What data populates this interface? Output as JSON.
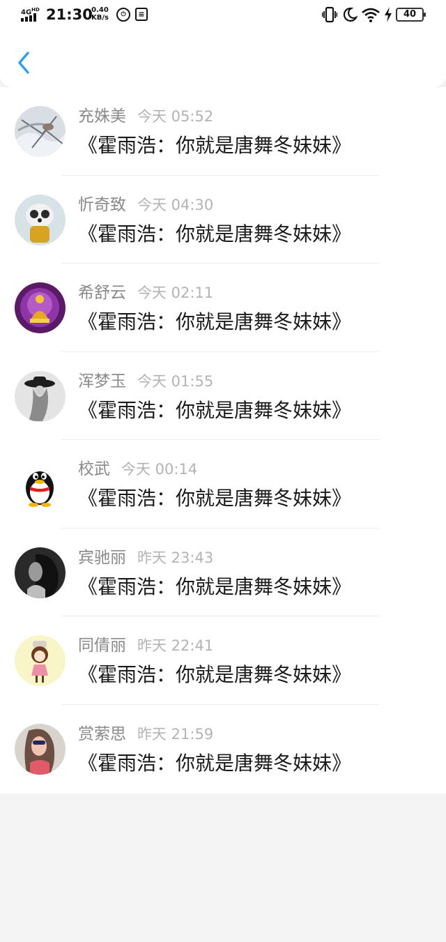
{
  "status_bar": {
    "network": "4G",
    "network_sup": "HD",
    "time": "21:30",
    "speed_value": "0.40",
    "speed_unit": "KB/s",
    "battery": "40"
  },
  "header": {
    "back_icon": "chevron-left-icon",
    "accent": "#2b9ef0"
  },
  "messages": [
    {
      "name": "充姝美",
      "time": "今天 05:52",
      "text": "《霍雨浩：你就是唐舞冬妹妹》"
    },
    {
      "name": "忻奇致",
      "time": "今天 04:30",
      "text": "《霍雨浩：你就是唐舞冬妹妹》"
    },
    {
      "name": "希舒云",
      "time": "今天 02:11",
      "text": "《霍雨浩：你就是唐舞冬妹妹》"
    },
    {
      "name": "浑梦玉",
      "time": "今天 01:55",
      "text": "《霍雨浩：你就是唐舞冬妹妹》"
    },
    {
      "name": "校武",
      "time": "今天 00:14",
      "text": "《霍雨浩：你就是唐舞冬妹妹》"
    },
    {
      "name": "宾驰丽",
      "time": "昨天 23:43",
      "text": "《霍雨浩：你就是唐舞冬妹妹》"
    },
    {
      "name": "同倩丽",
      "time": "昨天 22:41",
      "text": "《霍雨浩：你就是唐舞冬妹妹》"
    },
    {
      "name": "赏萦思",
      "time": "昨天 21:59",
      "text": "《霍雨浩：你就是唐舞冬妹妹》"
    }
  ]
}
